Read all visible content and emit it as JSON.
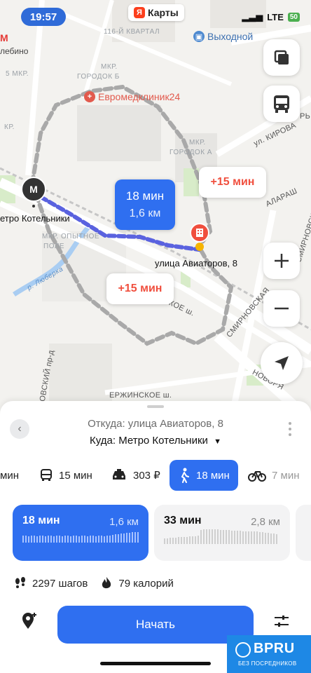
{
  "status": {
    "time": "19:57",
    "network": "LTE",
    "battery": "50"
  },
  "map": {
    "app_name": "Карты",
    "labels": [
      "лебино",
      "116-Й КВАРТАЛ",
      "5 МКР.",
      "МКР.",
      "ГОРОДОК Б",
      "КР.",
      "МКР.",
      "ГОРОДОК А",
      "ул. КИРОВА",
      "АЛАРАШ",
      "СМИРНОВСКАЯ УЛ.",
      "МКР. ОПЫТНОЕ",
      "ПОЛЕ",
      "р. Люберка",
      "СКОЕ ш.",
      "СМИРНОВСКАЯ",
      "НОВОРЯ",
      "ЕРЖИНСКОЕ ш.",
      "ОВСКИЙ пр-д",
      "РЬ"
    ],
    "poi": {
      "vykhodnoy": "Выходной",
      "clinic": "Евромедклиник24"
    },
    "metro": {
      "letter": "М",
      "label": "етро Котельники"
    },
    "destination": {
      "label": "улица Авиаторов, 8"
    },
    "bubbles": {
      "walk_time": "18 мин",
      "walk_distance": "1,6 км",
      "alt1": "+15 мин",
      "alt2": "+15 мин"
    },
    "icons": [
      "layers-icon",
      "bus-icon",
      "plus-icon",
      "minus-icon",
      "location-arrow-icon"
    ]
  },
  "sheet": {
    "from": "Откуда: улица Авиаторов, 8",
    "to": "Куда: Метро Котельники",
    "modes": [
      {
        "label": "мин",
        "icon": "car-icon"
      },
      {
        "label": "15 мин",
        "icon": "bus-icon"
      },
      {
        "label": "303 ₽",
        "icon": "taxi-icon"
      },
      {
        "label": "18 мин",
        "icon": "walk-icon"
      },
      {
        "label": "7 мин",
        "icon": "bike-icon"
      }
    ],
    "variants": [
      {
        "time": "18 мин",
        "distance": "1,6 км"
      },
      {
        "time": "33 мин",
        "distance": "2,8 км"
      }
    ],
    "steps": "2297 шагов",
    "calories": "79 калорий",
    "start_label": "Начать"
  },
  "badge": {
    "title": "BPRU",
    "subtitle": "БЕЗ ПОСРЕДНИКОВ"
  },
  "colors": {
    "accent": "#2f6ff0",
    "route_alt": "#a9a9a9",
    "warning": "#f04f3e",
    "metro": "#333333"
  }
}
